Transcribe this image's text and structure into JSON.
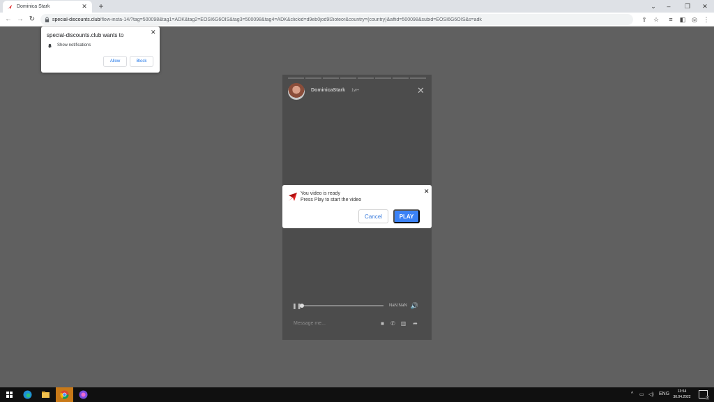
{
  "browser": {
    "tab_title": "Dominica Stark",
    "url_host": "special-discounts.club",
    "url_path": "/flow-insta-14/?tag=500098&tag1=ADK&tag2=EOSI6G6OIS&tag3=500098&tag4=ADK&clickid=d9eb0jod9l2ioteor&country={country}&affid=500098&subid=EOSI6G6OIS&s=adk"
  },
  "notification_prompt": {
    "title": "special-discounts.club wants to",
    "permission": "Show notifications",
    "allow_label": "Allow",
    "block_label": "Block"
  },
  "story": {
    "username": "DominicaStark",
    "time": "1w+",
    "progress_segments": 8,
    "player_time": "NaN:NaN",
    "message_placeholder": "Message me..."
  },
  "video_dialog": {
    "line1": "You video is ready",
    "line2": "Press Play to start the video",
    "cancel_label": "Cancel",
    "play_label": "PLAY",
    "accent_color": "#3b82f6"
  },
  "taskbar": {
    "lang": "ENG",
    "time": "13:54",
    "date": "30.04.2022",
    "notifications": "2"
  }
}
